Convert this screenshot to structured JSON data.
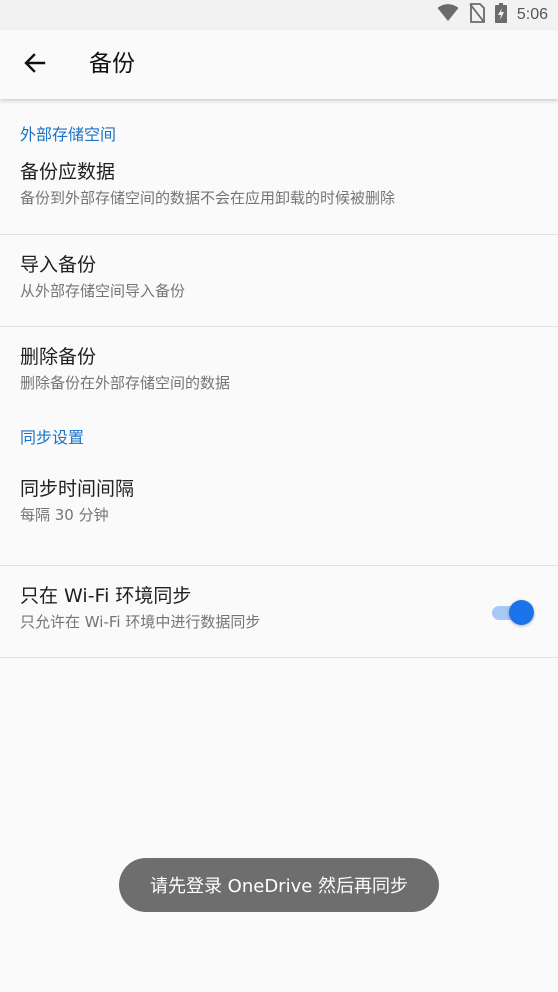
{
  "status_bar": {
    "time": "5:06",
    "icons": [
      "wifi-icon",
      "no-sim-icon",
      "battery-charging-icon"
    ]
  },
  "app_bar": {
    "back_icon": "arrow-back-icon",
    "title": "备份"
  },
  "sections": {
    "external_storage": {
      "header": "外部存储空间",
      "backup_data": {
        "title": "备份应数据",
        "summary": "备份到外部存储空间的数据不会在应用卸载的时候被删除"
      },
      "import_backup": {
        "title": "导入备份",
        "summary": "从外部存储空间导入备份"
      },
      "delete_backup": {
        "title": "删除备份",
        "summary": "删除备份在外部存储空间的数据"
      }
    },
    "sync": {
      "header": "同步设置",
      "sync_interval": {
        "title": "同步时间间隔",
        "summary": "每隔 30 分钟"
      },
      "wifi_only": {
        "title": "只在 Wi-Fi 环境同步",
        "summary": "只允许在 Wi-Fi 环境中进行数据同步",
        "enabled": true
      }
    }
  },
  "toast": {
    "message": "请先登录 OneDrive 然后再同步"
  },
  "colors": {
    "accent": "#1a73e8",
    "category_text": "#1a73c8",
    "toast_bg": "#6e6e6e"
  }
}
